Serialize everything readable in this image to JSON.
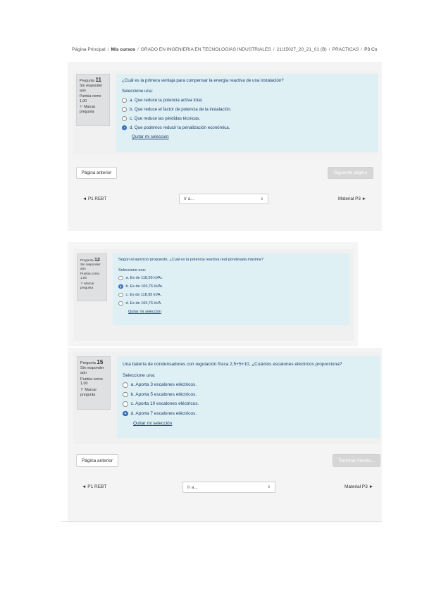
{
  "breadcrumb": [
    "Página Principal",
    "Mis cursos",
    "GRADO EN INGENIERÍA EN TECNOLOGÍAS INDUSTRIALES",
    "21/15027_20_21_01 (B)",
    "PRACTICAS",
    "P3 Co"
  ],
  "q11": {
    "label": "Pregunta",
    "number": "11",
    "status": "Sin responder aún",
    "points": "Puntúa como 1,00",
    "flag": "Marcar pregunta",
    "text": "¿Cuál es la primera ventaja para compensar la energía reactiva de una instalación?",
    "prompt": "Seleccione una:",
    "options": [
      "a. Que reduce la potencia activa total.",
      "b. Que reduce el factor de potencia de la instalación.",
      "c. Que reduce las pérdidas técnicas.",
      "d. Que podemos reducir la penalización económica."
    ],
    "selected_index": 3,
    "clear": "Quitar mi selección"
  },
  "nav1": {
    "prev": "Página anterior",
    "next": "Siguiente página",
    "left_link": "◄ P1 REBT",
    "jump": "Ir a...",
    "right_link": "Material P3 ►"
  },
  "q12": {
    "label": "Pregunta",
    "number": "12",
    "status": "Sin responder aún",
    "points": "Puntúa como 1,00",
    "flag": "Marcar pregunta",
    "text": "Según el ejercicio propuesto, ¿Cuál es la potencia reactiva real ponderada máxima?",
    "prompt": "Seleccione una:",
    "options": [
      "a. Es de 118,95 kVAr.",
      "b. Es de 166,76 kVAr.",
      "c. Es de 118,95 kVA.",
      "d. Es de 166,76 kVA."
    ],
    "selected_index": 1,
    "clear": "Quitar mi selección"
  },
  "q15": {
    "label": "Pregunta",
    "number": "15",
    "status": "Sin responder aún",
    "points": "Puntúa como 1,00",
    "flag": "Marcar pregunta",
    "text": "Una batería de condensadores con regulación física 2,5+5+10, ¿Cuántos escalones eléctricos proporciona?",
    "prompt": "Seleccione una:",
    "options": [
      "a. Aporta 3 escalones eléctricos.",
      "b. Aporta 5 escalones eléctricos.",
      "c. Aporta 10 escalones eléctricos.",
      "d. Aporta 7 escalones eléctricos."
    ],
    "selected_index": 3,
    "clear": "Quitar mi selección"
  },
  "nav3": {
    "prev": "Página anterior",
    "finish": "Terminar intento...",
    "left_link": "◄ P1 REBT",
    "jump": "Ir a...",
    "right_link": "Material P3 ►"
  },
  "icons": {
    "flag": "flag-icon",
    "select_arrow": "select-arrow-icon"
  },
  "colors": {
    "question_bg": "#dff0f5",
    "info_bg": "#dfe0e2",
    "panel_bg": "#f4f4f4",
    "radio_checked": "#4a79c9"
  }
}
